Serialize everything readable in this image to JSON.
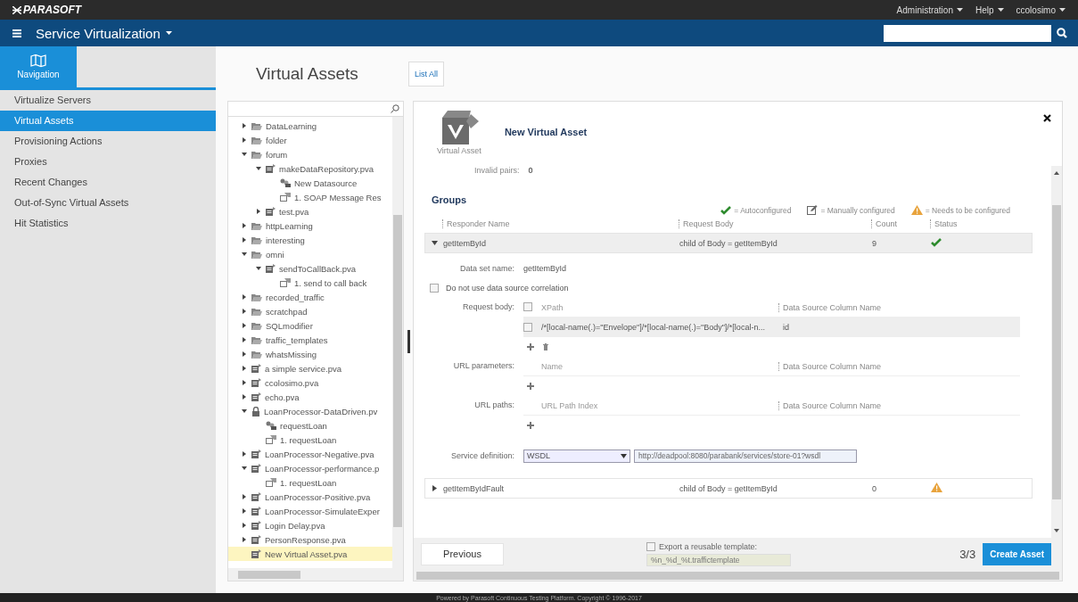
{
  "topbar": {
    "logo": "PARASOFT",
    "menus": [
      "Administration",
      "Help",
      "ccolosimo"
    ]
  },
  "navbar": {
    "title": "Service Virtualization"
  },
  "sidebar": {
    "tile_label": "Navigation",
    "items": [
      {
        "label": "Virtualize Servers",
        "selected": false
      },
      {
        "label": "Virtual Assets",
        "selected": true
      },
      {
        "label": "Provisioning Actions",
        "selected": false
      },
      {
        "label": "Proxies",
        "selected": false
      },
      {
        "label": "Recent Changes",
        "selected": false
      },
      {
        "label": "Out-of-Sync Virtual Assets",
        "selected": false
      },
      {
        "label": "Hit Statistics",
        "selected": false
      }
    ]
  },
  "page": {
    "title": "Virtual Assets",
    "list_all_button": "List All"
  },
  "tree": {
    "items": [
      {
        "kind": "folder",
        "label": "DataLearning",
        "expanded": false,
        "selected": false
      },
      {
        "kind": "folder",
        "label": "folder",
        "expanded": false,
        "selected": false
      },
      {
        "kind": "folder",
        "label": "forum",
        "expanded": true,
        "selected": false,
        "children": [
          {
            "kind": "pva",
            "label": "makeDataRepository.pva",
            "expanded": true,
            "selected": false,
            "children": [
              {
                "kind": "datasource",
                "label": "New Datasource",
                "selected": false
              },
              {
                "kind": "responder",
                "label": "1. SOAP Message Res",
                "selected": false
              }
            ]
          },
          {
            "kind": "pva",
            "label": "test.pva",
            "expanded": false,
            "selected": false
          }
        ]
      },
      {
        "kind": "folder",
        "label": "httpLearning",
        "expanded": false,
        "selected": false
      },
      {
        "kind": "folder",
        "label": "interesting",
        "expanded": false,
        "selected": false
      },
      {
        "kind": "folder",
        "label": "omni",
        "expanded": true,
        "selected": false,
        "children": [
          {
            "kind": "pva",
            "label": "sendToCallBack.pva",
            "expanded": true,
            "selected": false,
            "children": [
              {
                "kind": "responder",
                "label": "1. send to call back",
                "selected": false
              }
            ]
          }
        ]
      },
      {
        "kind": "folder",
        "label": "recorded_traffic",
        "expanded": false,
        "selected": false
      },
      {
        "kind": "folder",
        "label": "scratchpad",
        "expanded": false,
        "selected": false
      },
      {
        "kind": "folder",
        "label": "SQLmodifier",
        "expanded": false,
        "selected": false
      },
      {
        "kind": "folder",
        "label": "traffic_templates",
        "expanded": false,
        "selected": false
      },
      {
        "kind": "folder",
        "label": "whatsMissing",
        "expanded": false,
        "selected": false
      },
      {
        "kind": "pva",
        "label": "a simple service.pva",
        "expanded": false,
        "selected": false
      },
      {
        "kind": "pva",
        "label": "ccolosimo.pva",
        "expanded": false,
        "selected": false
      },
      {
        "kind": "pva",
        "label": "echo.pva",
        "expanded": false,
        "selected": false
      },
      {
        "kind": "locked",
        "label": "LoanProcessor-DataDriven.pv",
        "expanded": true,
        "selected": false,
        "children": [
          {
            "kind": "datasource",
            "label": "requestLoan",
            "selected": false
          },
          {
            "kind": "responder",
            "label": "1. requestLoan",
            "selected": false
          }
        ]
      },
      {
        "kind": "pva",
        "label": "LoanProcessor-Negative.pva",
        "expanded": false,
        "selected": false
      },
      {
        "kind": "pva",
        "label": "LoanProcessor-performance.p",
        "expanded": true,
        "selected": false,
        "children": [
          {
            "kind": "responder",
            "label": "1. requestLoan",
            "selected": false
          }
        ]
      },
      {
        "kind": "pva",
        "label": "LoanProcessor-Positive.pva",
        "expanded": false,
        "selected": false
      },
      {
        "kind": "pva",
        "label": "LoanProcessor-SimulateExper",
        "expanded": false,
        "selected": false
      },
      {
        "kind": "pva",
        "label": "Login Delay.pva",
        "expanded": false,
        "selected": false
      },
      {
        "kind": "pva",
        "label": "PersonResponse.pva",
        "expanded": false,
        "selected": false
      },
      {
        "kind": "pva",
        "label": "New Virtual Asset.pva",
        "selected": true
      }
    ]
  },
  "wizard": {
    "icon_label": "Virtual Asset",
    "title": "New Virtual Asset",
    "invalid_pairs_label": "Invalid pairs:",
    "invalid_pairs_value": "0",
    "groups_title": "Groups",
    "legend": [
      {
        "kind": "auto",
        "label": "= Autoconfigured"
      },
      {
        "kind": "manual",
        "label": "= Manually configured"
      },
      {
        "kind": "needs",
        "label": "= Needs to be configured"
      }
    ],
    "columns": [
      "Responder Name",
      "Request Body",
      "Count",
      "Status"
    ],
    "rows": [
      {
        "name": "getItemById",
        "request_body": "child of Body = getItemById",
        "count": "9",
        "kind": "auto",
        "expanded": true,
        "details": {
          "data_set_label": "Data set name:",
          "data_set_value": "getItemById",
          "correlation": {
            "label": "Do not use data source correlation",
            "checked": false
          },
          "request_body": {
            "label": "Request body:",
            "header_checked": false,
            "columns": [
              "XPath",
              "Data Source Column Name"
            ],
            "rows": [
              {
                "checked": false,
                "xpath": "/*[local-name(.)=\"Envelope\"]/*[local-name(.)=\"Body\"]/*[local-n...",
                "column": "id"
              }
            ]
          },
          "url_parameters": {
            "label": "URL parameters:",
            "columns": [
              "Name",
              "Data Source Column Name"
            ]
          },
          "url_paths": {
            "label": "URL paths:",
            "columns": [
              "URL Path Index",
              "Data Source Column Name"
            ]
          },
          "service_definition": {
            "label": "Service definition:",
            "type": "WSDL",
            "url": "http://deadpool:8080/parabank/services/store-01?wsdl"
          }
        }
      },
      {
        "name": "getItemByIdFault",
        "request_body": "child of Body = getItemById",
        "count": "0",
        "kind": "needs",
        "expanded": false
      }
    ],
    "footer": {
      "previous_button": "Previous",
      "export": {
        "label": "Export a reusable template:",
        "checked": false,
        "value": "%n_%d_%t.traffictemplate"
      },
      "step": "3/3",
      "create_button": "Create Asset"
    }
  },
  "footer": {
    "text": "Powered by Parasoft Continuous Testing Platform. Copyright © 1996-2017"
  }
}
